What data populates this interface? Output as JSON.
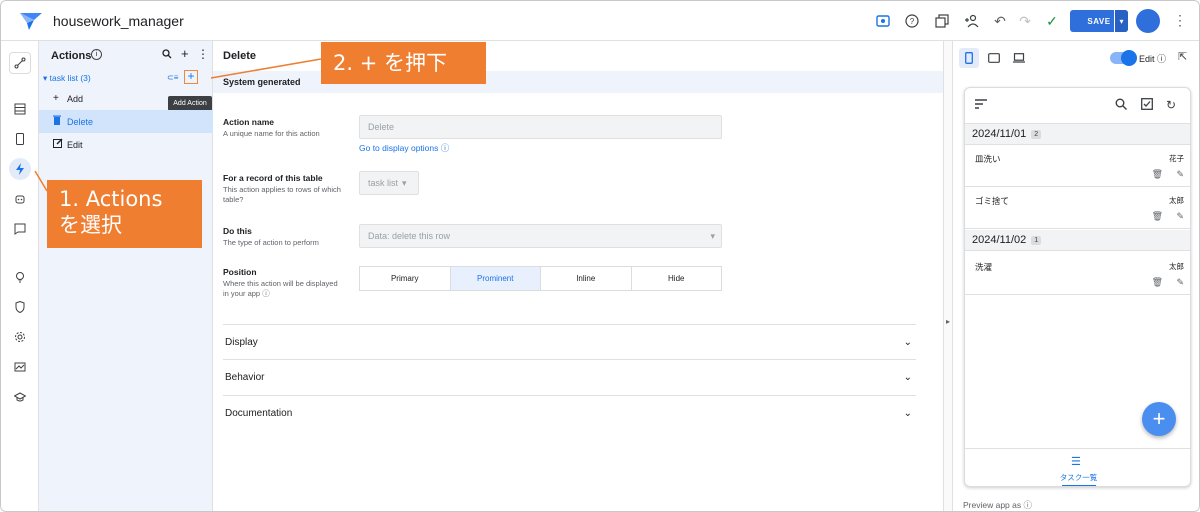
{
  "app": {
    "title": "housework_manager",
    "save_label": "SAVE",
    "colors": {
      "accent": "#1a73e8",
      "callout": "#ef7e31",
      "panel_bg": "#eef3fc"
    }
  },
  "toolbar_icons": [
    "preview-icon",
    "help-icon",
    "copy-icon",
    "add-person-icon",
    "undo-icon",
    "redo-icon",
    "check-icon"
  ],
  "rail_icons": [
    "route-icon",
    "table-icon",
    "phone-icon",
    "bolt-icon",
    "bot-icon",
    "chat-icon",
    "bulb-icon",
    "shield-icon",
    "gear-icon",
    "monitor-icon",
    "school-icon"
  ],
  "actions_panel": {
    "title": "Actions",
    "table_row": "▾ task list (3)",
    "tooltip": "Add Action",
    "items": [
      {
        "label": "Add",
        "icon": "plus-icon"
      },
      {
        "label": "Delete",
        "icon": "trash-icon"
      },
      {
        "label": "Edit",
        "icon": "edit-icon"
      }
    ]
  },
  "editor": {
    "title": "Delete",
    "section_label": "System generated",
    "action_name": {
      "label": "Action name",
      "help": "A unique name for this action",
      "value": "Delete",
      "link": "Go to display options"
    },
    "for_record": {
      "label": "For a record of this table",
      "help": "This action applies to rows of which table?",
      "value": "task list"
    },
    "do_this": {
      "label": "Do this",
      "help": "The type of action to perform",
      "value": "Data: delete this row"
    },
    "position": {
      "label": "Position",
      "help": "Where this action will be displayed in your app",
      "options": [
        "Primary",
        "Prominent",
        "Inline",
        "Hide"
      ],
      "selected": "Prominent"
    },
    "sections": [
      "Display",
      "Behavior",
      "Documentation"
    ]
  },
  "preview": {
    "edit_label": "Edit",
    "preview_as": "Preview app as",
    "groups": [
      {
        "date": "2024/11/01",
        "count": "2",
        "rows": [
          {
            "title": "皿洗い",
            "who": "花子"
          },
          {
            "title": "ゴミ捨て",
            "who": "太郎"
          }
        ]
      },
      {
        "date": "2024/11/02",
        "count": "1",
        "rows": [
          {
            "title": "洗濯",
            "who": "太郎"
          }
        ]
      }
    ],
    "bottom_nav_label": "タスク一覧"
  },
  "annotations": {
    "step1_line1": "1. Actions",
    "step1_line2": "を選択",
    "step2": "2. + を押下"
  }
}
